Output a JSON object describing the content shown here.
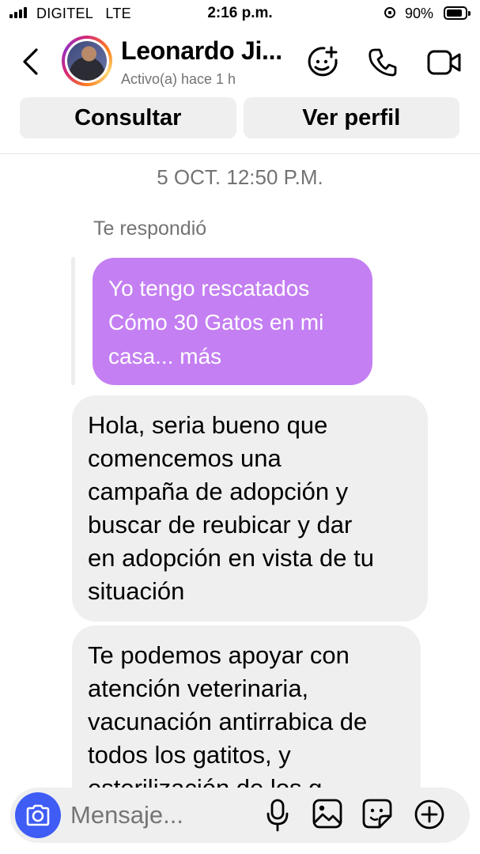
{
  "status_bar": {
    "carrier": "DIGITEL   LTE",
    "time": "2:16 p.m.",
    "battery": "90%",
    "battery_level": 0.9
  },
  "header": {
    "contact_name": "Leonardo Ji...",
    "contact_status": "Activo(a) hace 1 h",
    "icons": [
      "back-chevron-icon",
      "avatar-effects-icon",
      "phone-icon",
      "video-camera-icon"
    ]
  },
  "actions": {
    "consult_label": "Consultar",
    "profile_label": "Ver perfil"
  },
  "thread": {
    "date_separator": "5 OCT. 12:50 P.M.",
    "reply_label": "Te respondió",
    "quoted_message": {
      "lines": [
        "Yo tengo rescatados",
        "Cómo 30 Gatos en mi",
        "casa... más"
      ]
    },
    "messages": [
      {
        "lines": [
          "Hola, seria bueno que",
          "comencemos una",
          "campaña de adopción y",
          "buscar de reubicar y dar",
          "en adopción en vista de tu",
          "situación"
        ]
      },
      {
        "lines": [
          "Te podemos apoyar con",
          "atención veterinaria,",
          "vacunación antirrabica de",
          "todos los gatitos, y",
          "esterilización de los g..."
        ]
      }
    ]
  },
  "composer": {
    "placeholder": "Mensaje...",
    "icons": [
      "camera-icon",
      "microphone-icon",
      "gallery-icon",
      "sticker-icon",
      "add-icon"
    ]
  },
  "colors": {
    "accent_blue": "#3f5cf5",
    "reply_bubble": "#c47ff2",
    "bubble_gray": "#efefef",
    "secondary_text": "#737373"
  }
}
